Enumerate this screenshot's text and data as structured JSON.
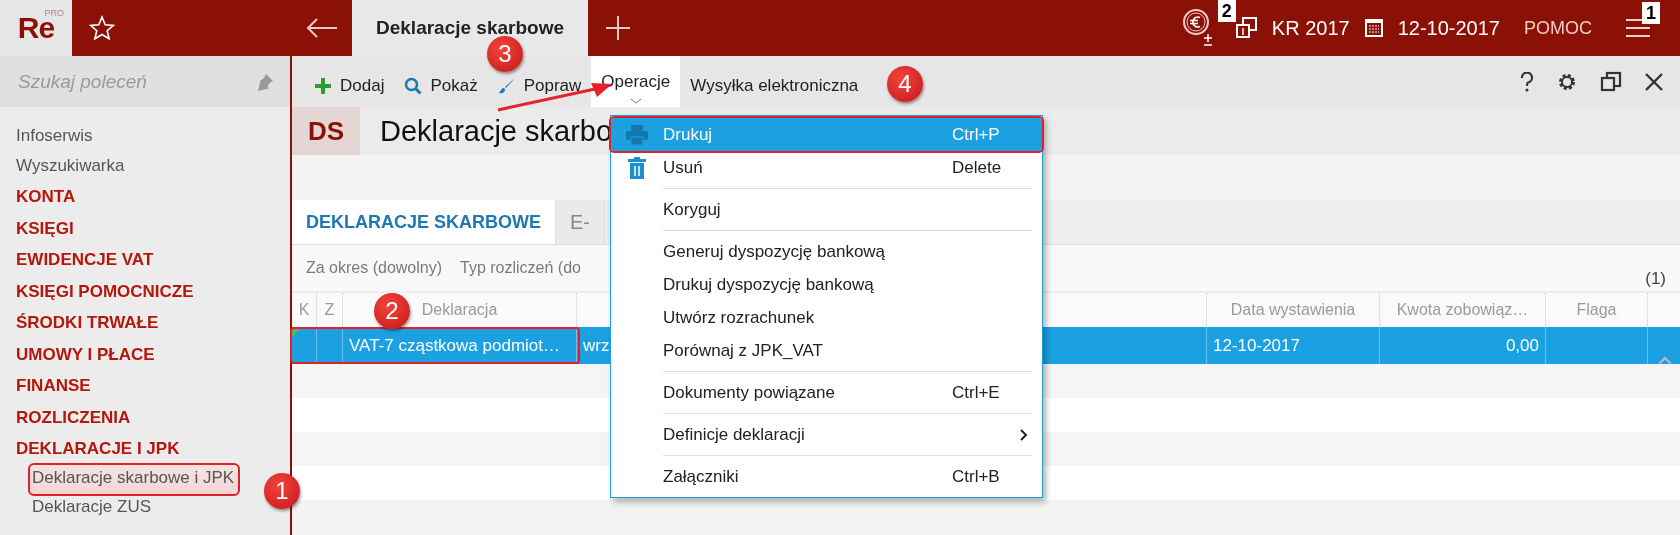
{
  "top_bar": {
    "logo": {
      "text": "Re",
      "badge": "PRO"
    },
    "open_tab": {
      "label": "Deklaracje skarbowe",
      "selected": true
    },
    "period": "KR 2017",
    "date": "12-10-2017",
    "help": "POMOC",
    "corner_markers": [
      "2",
      "1"
    ]
  },
  "sidebar": {
    "search": {
      "placeholder": "Szukaj poleceń"
    },
    "items": [
      {
        "label": "Infoserwis",
        "kind": "link"
      },
      {
        "label": "Wyszukiwarka",
        "kind": "link"
      },
      {
        "label": "KONTA",
        "kind": "section"
      },
      {
        "label": "KSIĘGI",
        "kind": "section"
      },
      {
        "label": "EWIDENCJE VAT",
        "kind": "section"
      },
      {
        "label": "KSIĘGI POMOCNICZE",
        "kind": "section"
      },
      {
        "label": "ŚRODKI TRWAŁE",
        "kind": "section"
      },
      {
        "label": "UMOWY I PŁACE",
        "kind": "section"
      },
      {
        "label": "FINANSE",
        "kind": "section"
      },
      {
        "label": "ROZLICZENIA",
        "kind": "section"
      },
      {
        "label": "DEKLARACJE I JPK",
        "kind": "section",
        "children": [
          {
            "label": "Deklaracje skarbowe i JPK",
            "selected": true,
            "annotated": true
          },
          {
            "label": "Deklaracje ZUS",
            "selected": false,
            "annotated": false
          }
        ]
      }
    ]
  },
  "toolbar": {
    "actions": [
      {
        "label": "Dodaj",
        "kind": "add",
        "selected": false
      },
      {
        "label": "Pokaż",
        "kind": "show",
        "selected": false
      },
      {
        "label": "Popraw",
        "kind": "edit",
        "selected": false
      },
      {
        "label": "Operacje",
        "kind": "dropdown",
        "selected": true
      },
      {
        "label": "Wysyłka elektroniczna",
        "kind": "plain",
        "selected": false
      }
    ]
  },
  "header": {
    "badge": "DS",
    "title": "Deklaracje skarbo"
  },
  "tabs": [
    {
      "label": "DEKLARACJE SKARBOWE",
      "selected": true
    },
    {
      "label": "E-",
      "selected": false
    }
  ],
  "filters": [
    "Za okres (dowolny)",
    "Typ rozliczeń (do"
  ],
  "count": "(1)",
  "table": {
    "columns": [
      "K",
      "Z",
      "Deklaracja",
      "Data wystawienia",
      "Kwota zobowiąz…",
      "Flaga"
    ],
    "rows": [
      {
        "selected": true,
        "marked": true,
        "annotated": true,
        "deklaracja": "VAT-7 cząstkowa podmiot…",
        "column_4": "wrz",
        "data_wystawienia": "12-10-2017",
        "kwota": "0,00"
      }
    ]
  },
  "menu": {
    "groups": [
      [
        {
          "label": "Drukuj",
          "shortcut": "Ctrl+P",
          "selected": true,
          "annotated": true
        },
        {
          "label": "Usuń",
          "shortcut": "Delete",
          "selected": false,
          "annotated": false
        }
      ],
      [
        {
          "label": "Koryguj",
          "selected": false,
          "annotated": false
        }
      ],
      [
        {
          "label": "Generuj dyspozycję bankową",
          "selected": false,
          "annotated": false
        },
        {
          "label": "Drukuj dyspozycję bankową",
          "selected": false,
          "annotated": false
        },
        {
          "label": "Utwórz rozrachunek",
          "selected": false,
          "annotated": false
        },
        {
          "label": "Porównaj z JPK_VAT",
          "selected": false,
          "annotated": false
        }
      ],
      [
        {
          "label": "Dokumenty powiązane",
          "shortcut": "Ctrl+E",
          "selected": false,
          "annotated": false
        }
      ],
      [
        {
          "label": "Definicje deklaracji",
          "selected": false,
          "annotated": false,
          "has_submenu": true
        }
      ],
      [
        {
          "label": "Załączniki",
          "shortcut": "Ctrl+B",
          "selected": false,
          "annotated": false
        }
      ]
    ]
  },
  "callouts": [
    {
      "number": "1"
    },
    {
      "number": "2"
    },
    {
      "number": "3"
    },
    {
      "number": "4"
    }
  ]
}
